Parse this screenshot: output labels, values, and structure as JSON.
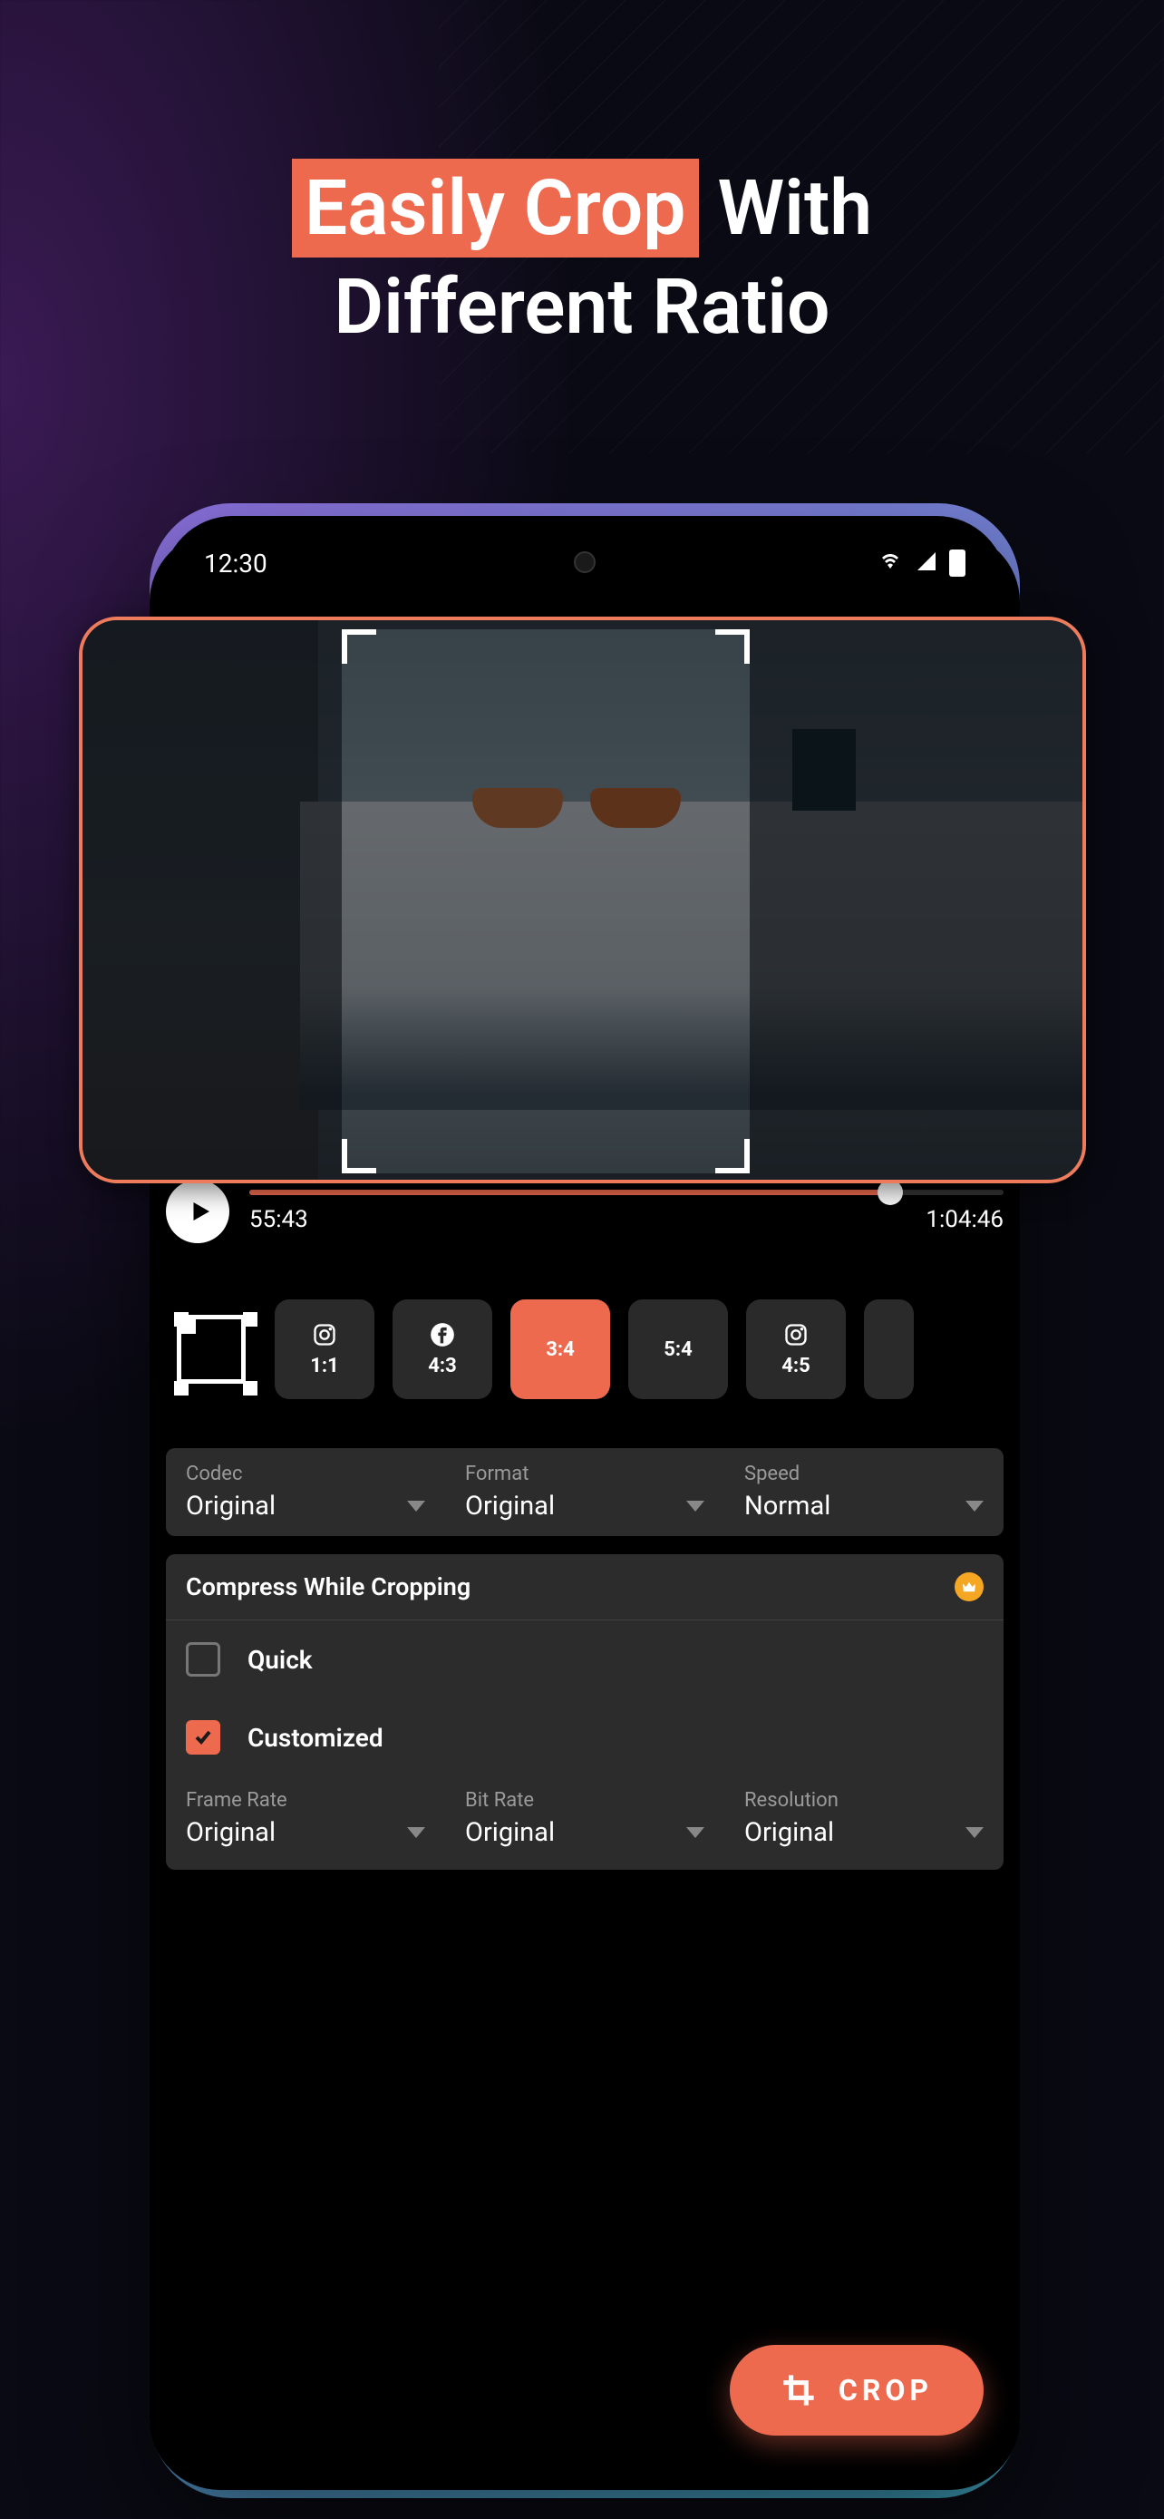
{
  "headline": {
    "highlight": "Easily Crop",
    "rest_line1": " With",
    "rest_line2": "Different Ratio"
  },
  "status": {
    "time": "12:30"
  },
  "player": {
    "current": "55:43",
    "total": "1:04:46"
  },
  "ratios": {
    "r0": {
      "label": "1:1"
    },
    "r1": {
      "label": "4:3"
    },
    "r2": {
      "label": "3:4"
    },
    "r3": {
      "label": "5:4"
    },
    "r4": {
      "label": "4:5"
    }
  },
  "settings": {
    "codec": {
      "label": "Codec",
      "value": "Original"
    },
    "format": {
      "label": "Format",
      "value": "Original"
    },
    "speed": {
      "label": "Speed",
      "value": "Normal"
    }
  },
  "compress": {
    "title": "Compress While Cropping",
    "quick": "Quick",
    "customized": "Customized",
    "framerate": {
      "label": "Frame Rate",
      "value": "Original"
    },
    "bitrate": {
      "label": "Bit Rate",
      "value": "Original"
    },
    "resolution": {
      "label": "Resolution",
      "value": "Original"
    }
  },
  "cta": {
    "label": "CROP"
  }
}
